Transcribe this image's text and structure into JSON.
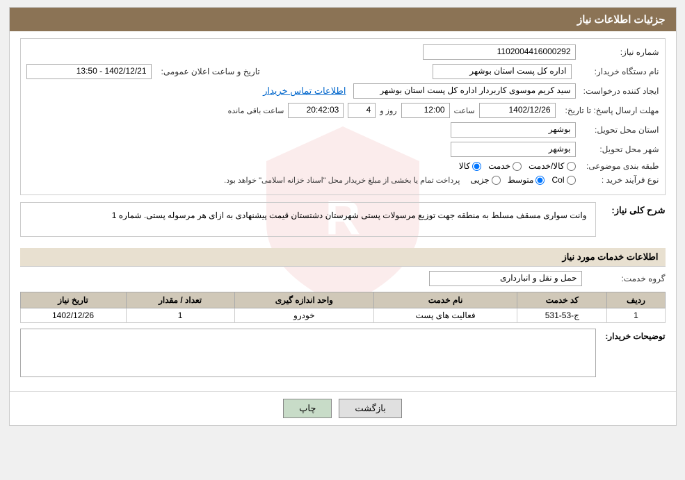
{
  "header": {
    "title": "جزئیات اطلاعات نیاز"
  },
  "fields": {
    "shomara_niaz_label": "شماره نیاز:",
    "shomara_niaz_value": "1102004416000292",
    "naam_dastgah_label": "نام دستگاه خریدار:",
    "naam_dastgah_value": "اداره کل پست استان بوشهر",
    "ijad_konande_label": "ایجاد کننده درخواست:",
    "ijad_konande_value": "سید کریم موسوی کاربردار اداره کل پست استان بوشهر",
    "etelaaat_link": "اطلاعات تماس خریدار",
    "mohlat_label": "مهلت ارسال پاسخ: تا تاریخ:",
    "mohlat_date": "1402/12/26",
    "mohlat_saat_label": "ساعت",
    "mohlat_saat": "12:00",
    "mohlat_roz_label": "روز و",
    "mohlat_roz": "4",
    "mohlat_saat2_label": "ساعت باقی مانده",
    "mohlat_saat2": "20:42:03",
    "ostan_tahvil_label": "استان محل تحویل:",
    "ostan_tahvil_value": "بوشهر",
    "shahr_tahvil_label": "شهر محل تحویل:",
    "shahr_tahvil_value": "بوشهر",
    "tabaqe_label": "طبقه بندی موضوعی:",
    "tabaqe_kala": "کالا",
    "tabaqe_khedmat": "خدمت",
    "tabaqe_kala_khedmat": "کالا/خدمت",
    "tabaqe_selected": "kala",
    "nooe_farayand_label": "نوع فرآیند خرید :",
    "nooe_jozyi": "جزیی",
    "nooe_motawaset": "متوسط",
    "nooe_col": "Col",
    "nooe_selected": "motawaset",
    "payment_note": "پرداخت تمام یا بخشی از مبلغ خریدار محل \"اسناد خزانه اسلامی\" خواهد بود.",
    "date_label": "تاریخ و ساعت اعلان عمومی:",
    "date_value": "1402/12/21 - 13:50"
  },
  "sharh_section": {
    "label": "شرح کلی نیاز:",
    "text": "وانت سواری مسقف مسلط به منطقه جهت توزیع مرسولات پستی شهرستان دشتستان قیمت پیشنهادی به ازای هر مرسوله پستی. شماره 1"
  },
  "khadamat_section": {
    "title": "اطلاعات خدمات مورد نیاز",
    "group_label": "گروه خدمت:",
    "group_value": "حمل و نقل و انبارداری"
  },
  "table": {
    "headers": [
      "ردیف",
      "کد خدمت",
      "نام خدمت",
      "واحد اندازه گیری",
      "تعداد / مقدار",
      "تاریخ نیاز"
    ],
    "rows": [
      {
        "radif": "1",
        "code": "ج-53-531",
        "name": "فعالیت های پست",
        "unit": "خودرو",
        "count": "1",
        "date": "1402/12/26"
      }
    ]
  },
  "description_section": {
    "label": "توضیحات خریدار:",
    "value": ""
  },
  "buttons": {
    "print": "چاپ",
    "back": "بازگشت"
  }
}
